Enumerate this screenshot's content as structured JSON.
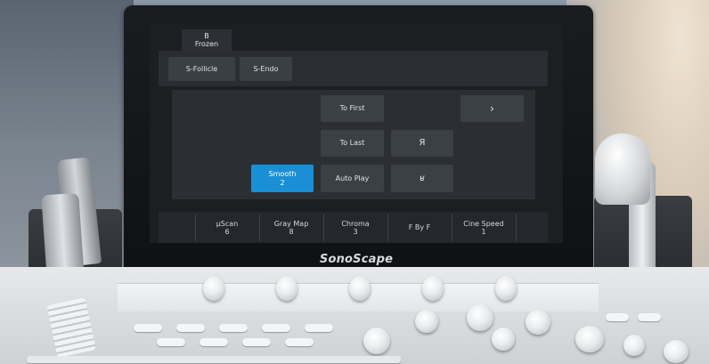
{
  "tab": {
    "line1": "B",
    "line2": "Frozen"
  },
  "presets": [
    {
      "label": "S-Follicle"
    },
    {
      "label": "S-Endo"
    }
  ],
  "controls": {
    "to_first": "To First",
    "to_last": "To Last",
    "auto_play": "Auto Play",
    "next_symbol": "›",
    "mirror_r": "Я",
    "mirror_k": "ʁ",
    "smooth": {
      "label": "Smooth",
      "value": "2"
    }
  },
  "knobs": [
    {
      "label": "μScan",
      "value": "6"
    },
    {
      "label": "Gray Map",
      "value": "8"
    },
    {
      "label": "Chroma",
      "value": "3"
    },
    {
      "label": "F By F",
      "value": ""
    },
    {
      "label": "Cine Speed",
      "value": "1"
    }
  ],
  "brand": "SonoScape",
  "colors": {
    "active": "#1a8fd6",
    "button": "#3b4046",
    "panel": "#2b2f34"
  }
}
